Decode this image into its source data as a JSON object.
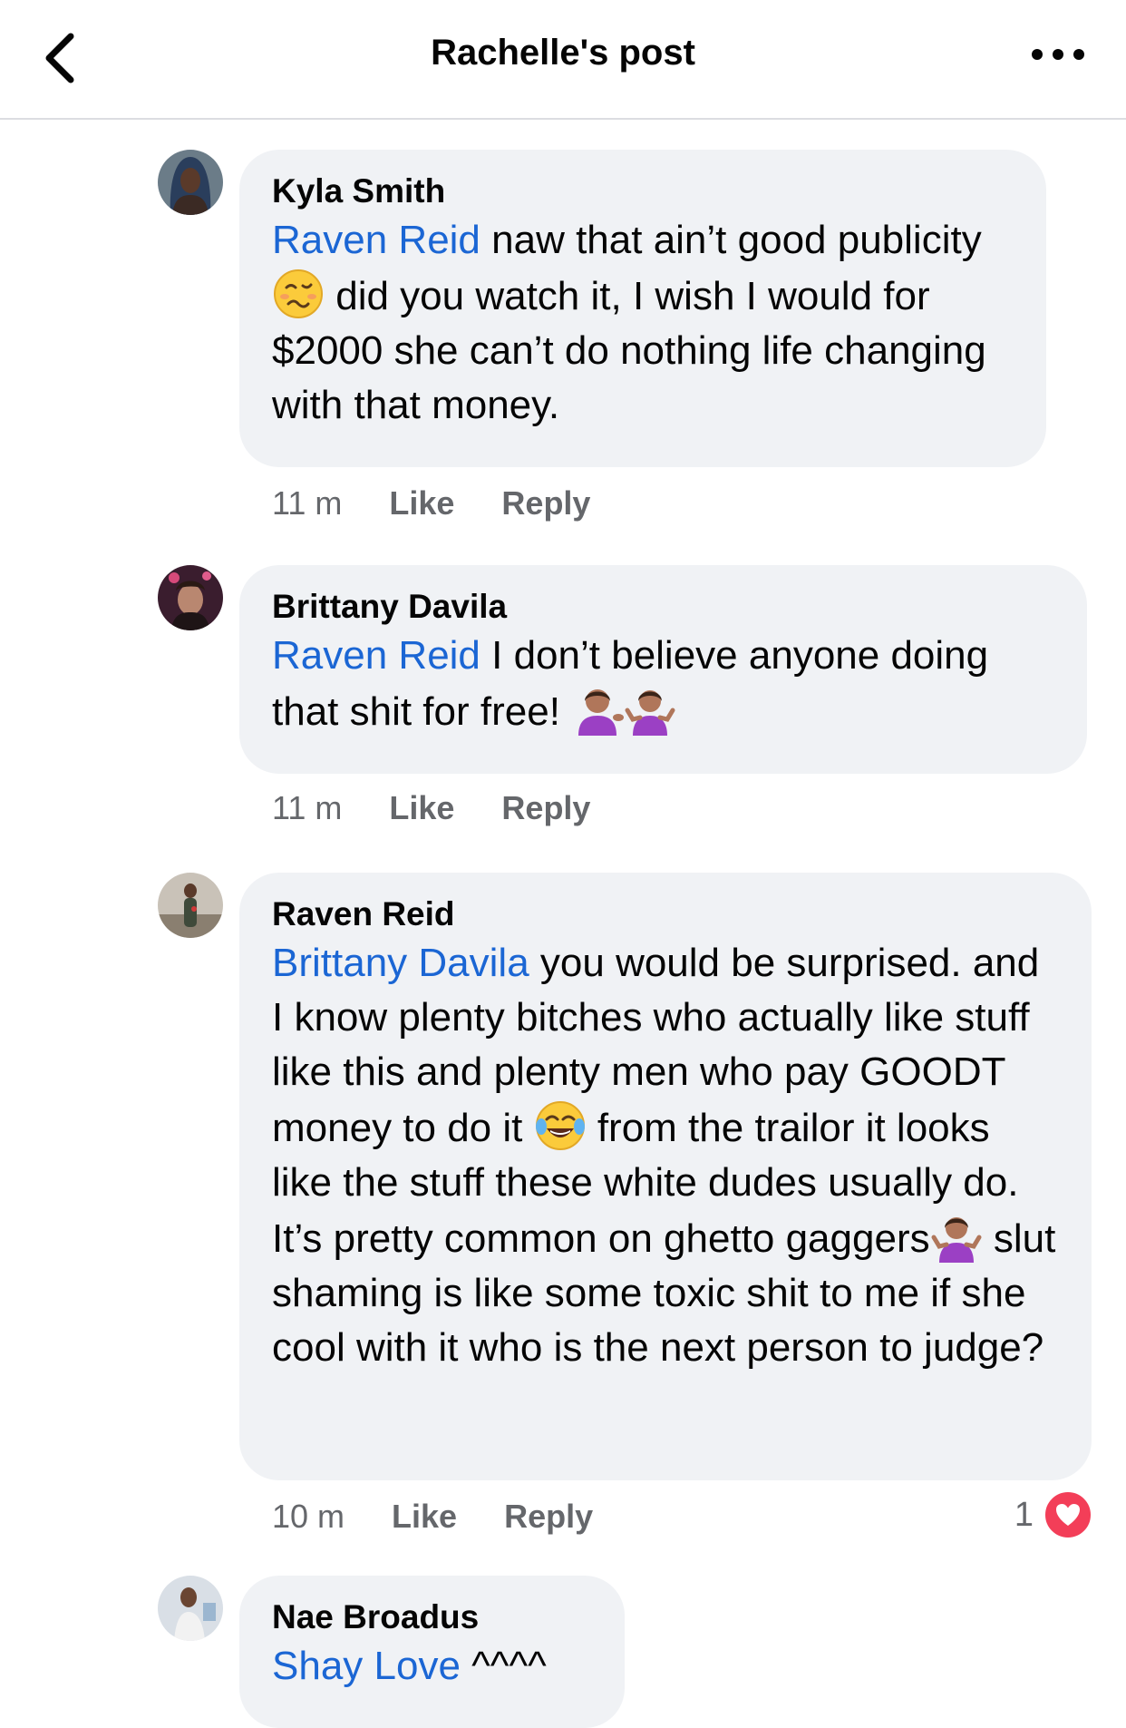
{
  "header": {
    "title": "Rachelle's post",
    "back_icon": "chevron-left-icon",
    "more_icon": "more-horizontal-icon"
  },
  "comments": [
    {
      "author": "Kyla Smith",
      "mention": "Raven Reid",
      "text_a": " naw that ain’t good publicity",
      "emoji_a": "woozy-face-emoji",
      "text_b": " did you watch it, I wish I would for $2000 she can’t do nothing life changing with that money.",
      "time": "11 m",
      "like": "Like",
      "reply": "Reply"
    },
    {
      "author": "Brittany Davila",
      "mention": "Raven Reid",
      "text_a": " I don’t believe anyone doing that shit for free! ",
      "emoji_a": "woman-tipping-hand-emoji",
      "emoji_b": "woman-shrugging-emoji",
      "time": "11 m",
      "like": "Like",
      "reply": "Reply"
    },
    {
      "author": "Raven Reid",
      "mention": "Brittany Davila",
      "text_a": " you would be surprised. and I know plenty bitches who actually like stuff like this and plenty men who pay GOODT money to do it ",
      "emoji_a": "tears-of-joy-emoji",
      "text_b": " from the trailor it looks like the stuff these white dudes usually do. It’s pretty common on ghetto gaggers",
      "emoji_b": "woman-shrugging-emoji",
      "text_c": " slut shaming is like some toxic shit to me if she cool with it who is the next person to judge?",
      "time": "10 m",
      "like": "Like",
      "reply": "Reply",
      "reaction_count": "1",
      "reaction_icon": "heart-reaction-icon"
    },
    {
      "author": "Nae Broadus",
      "mention": "Shay Love",
      "text_a": " ^^^^"
    }
  ],
  "colors": {
    "mention": "#1b66d4",
    "bubble": "#f0f2f5",
    "meta": "#65676b",
    "heart": "#f33e58"
  }
}
